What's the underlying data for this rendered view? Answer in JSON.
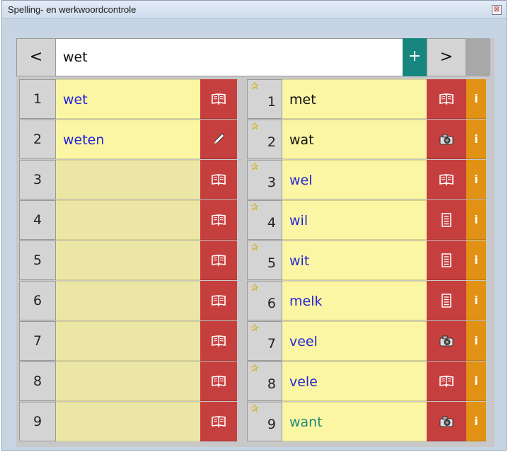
{
  "window": {
    "title": "Spelling- en werkwoordcontrole",
    "close_glyph": "⊠"
  },
  "toolbar": {
    "prev_label": "<",
    "next_label": ">",
    "search_value": "wet",
    "add_label": "+"
  },
  "left_list": [
    {
      "num": "1",
      "word": "wet",
      "icon": "book-icon"
    },
    {
      "num": "2",
      "word": "weten",
      "icon": "pencil-icon"
    },
    {
      "num": "3",
      "word": "",
      "icon": "book-icon"
    },
    {
      "num": "4",
      "word": "",
      "icon": "book-icon"
    },
    {
      "num": "5",
      "word": "",
      "icon": "book-icon"
    },
    {
      "num": "6",
      "word": "",
      "icon": "book-icon"
    },
    {
      "num": "7",
      "word": "",
      "icon": "book-icon"
    },
    {
      "num": "8",
      "word": "",
      "icon": "book-icon"
    },
    {
      "num": "9",
      "word": "",
      "icon": "book-icon"
    }
  ],
  "right_list": [
    {
      "num": "1",
      "word": "met",
      "color": "black",
      "icon": "book-icon",
      "info": "i"
    },
    {
      "num": "2",
      "word": "wat",
      "color": "black",
      "icon": "camera-icon",
      "info": "i"
    },
    {
      "num": "3",
      "word": "wel",
      "color": "blue",
      "icon": "book-icon",
      "info": "i"
    },
    {
      "num": "4",
      "word": "wil",
      "color": "blue",
      "icon": "document-icon",
      "info": "i"
    },
    {
      "num": "5",
      "word": "wit",
      "color": "blue",
      "icon": "document-icon",
      "info": "i"
    },
    {
      "num": "6",
      "word": "melk",
      "color": "blue",
      "icon": "document-icon",
      "info": "i"
    },
    {
      "num": "7",
      "word": "veel",
      "color": "blue",
      "icon": "camera-icon",
      "info": "i"
    },
    {
      "num": "8",
      "word": "vele",
      "color": "blue",
      "icon": "book-icon",
      "info": "i"
    },
    {
      "num": "9",
      "word": "want",
      "color": "teal",
      "icon": "camera-icon",
      "info": "i"
    }
  ],
  "colors": {
    "word_bg": "#fbf6a4",
    "action_red": "#c63f3f",
    "info_orange": "#e19214",
    "add_teal": "#17867e"
  }
}
